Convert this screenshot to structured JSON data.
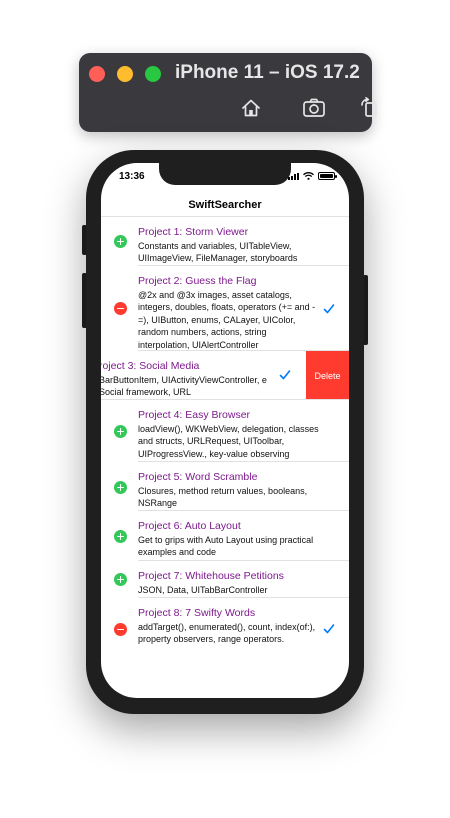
{
  "simulator": {
    "title": "iPhone 11 – iOS 17.2",
    "toolbar_buttons": [
      "home-icon",
      "screenshot-icon",
      "rotate-icon"
    ]
  },
  "status_bar": {
    "time": "13:36"
  },
  "nav": {
    "title": "SwiftSearcher"
  },
  "colors": {
    "title_purple": "#7d1a8c",
    "add_green": "#34c759",
    "delete_red": "#ff3b30",
    "check_blue": "#007aff"
  },
  "rows": [
    {
      "title": "Project 1: Storm Viewer",
      "subtitle": "Constants and variables, UITableView, UIImageView, FileManager, storyboards",
      "control": "add",
      "checked": false
    },
    {
      "title": "Project 2: Guess the Flag",
      "subtitle": "@2x and @3x images, asset catalogs, integers, doubles, floats, operators (+= and -=), UIButton, enums, CALayer, UIColor, random numbers, actions, string interpolation, UIAlertController",
      "control": "remove",
      "checked": true
    },
    {
      "title": "roject 3: Social Media",
      "subtitle": "BarButtonItem, UIActivityViewController, e Social framework, URL",
      "control": "swiped",
      "checked": true,
      "delete_label": "Delete"
    },
    {
      "title": "Project 4: Easy Browser",
      "subtitle": "loadView(), WKWebView, delegation, classes and structs, URLRequest, UIToolbar, UIProgressView., key-value observing",
      "control": "add",
      "checked": false
    },
    {
      "title": "Project 5: Word Scramble",
      "subtitle": "Closures, method return values, booleans, NSRange",
      "control": "add",
      "checked": false
    },
    {
      "title": "Project 6: Auto Layout",
      "subtitle": "Get to grips with Auto Layout using practical examples and code",
      "control": "add",
      "checked": false
    },
    {
      "title": "Project 7: Whitehouse Petitions",
      "subtitle": "JSON, Data, UITabBarController",
      "control": "add",
      "checked": false
    },
    {
      "title": "Project 8: 7 Swifty Words",
      "subtitle": "addTarget(), enumerated(), count, index(of:), property observers, range operators.",
      "control": "remove",
      "checked": true
    }
  ]
}
